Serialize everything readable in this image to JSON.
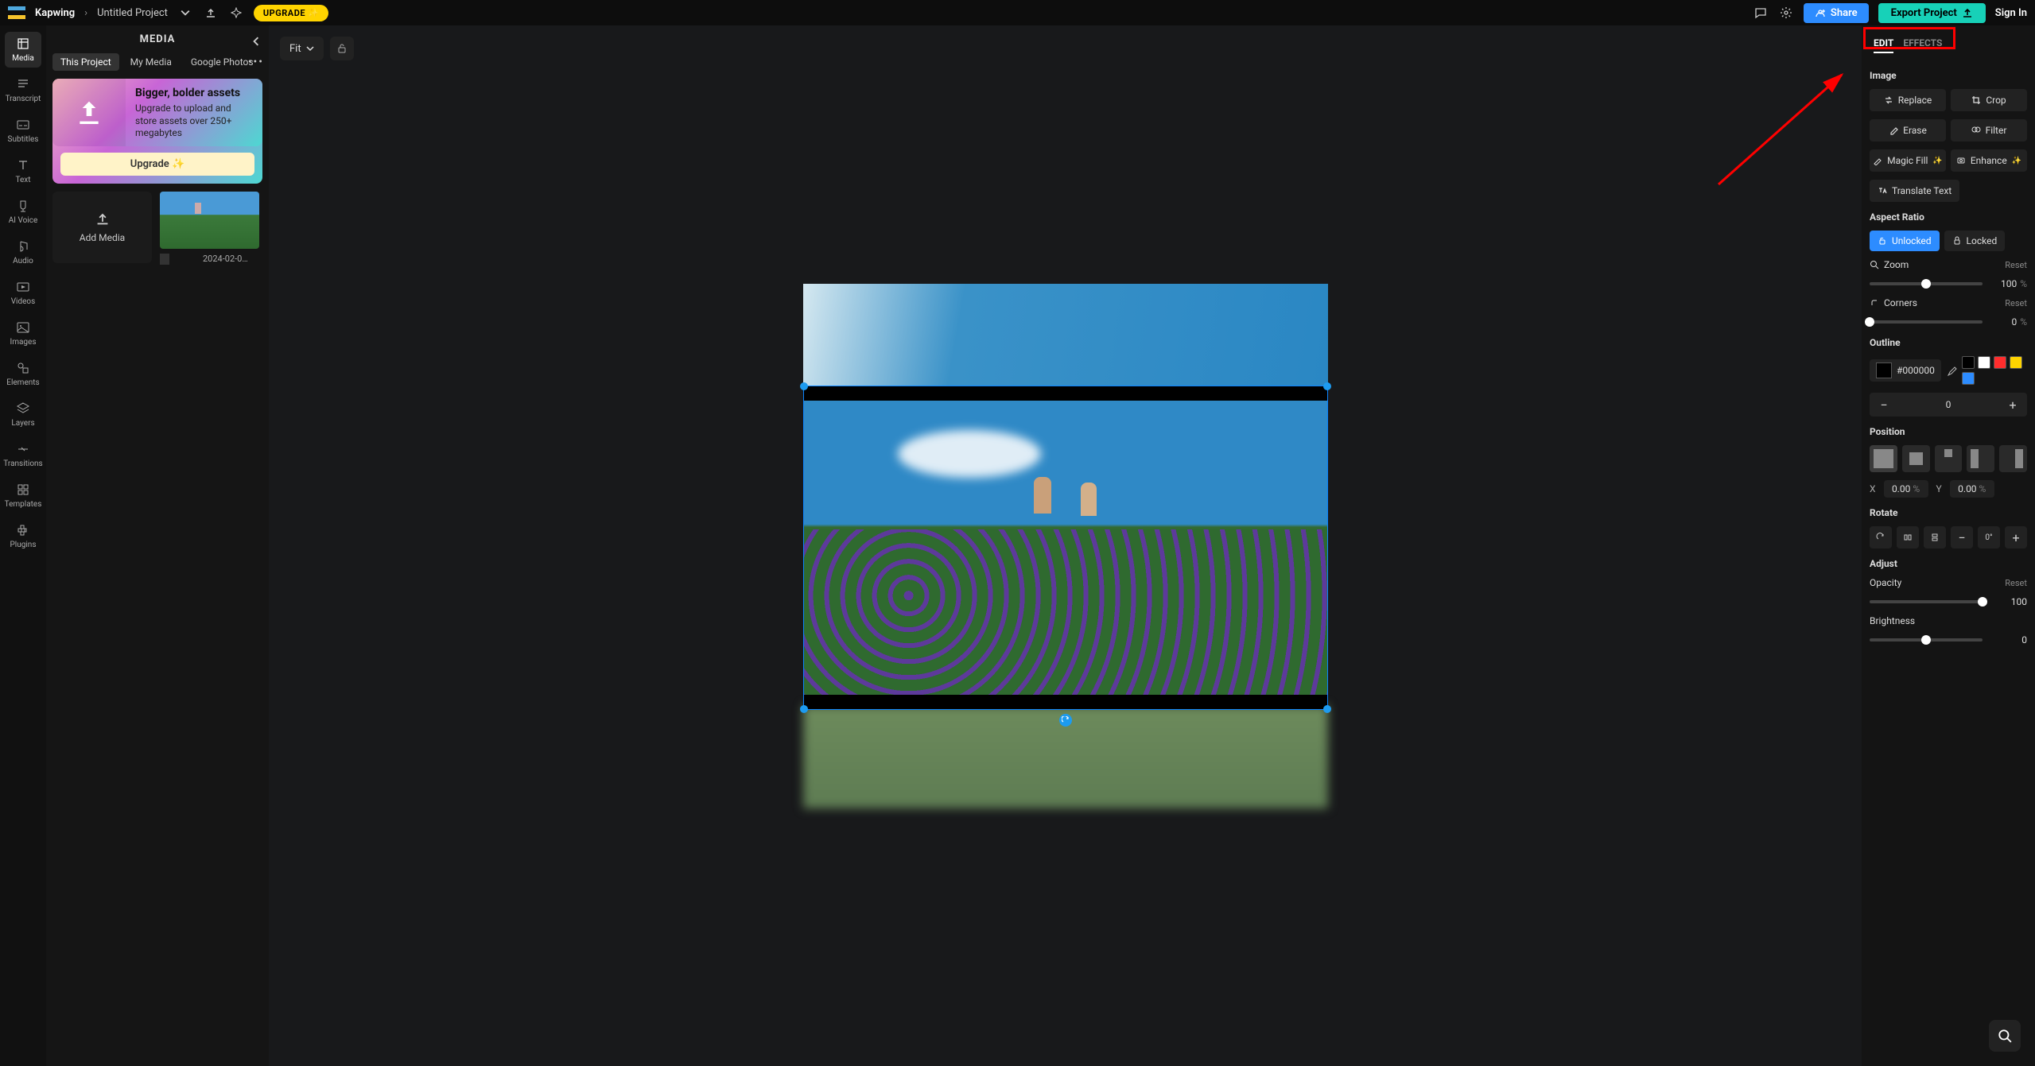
{
  "top": {
    "brand": "Kapwing",
    "project": "Untitled Project",
    "upgrade_pill": "UPGRADE ✨",
    "share": "Share",
    "export": "Export Project",
    "signin": "Sign In"
  },
  "rail": [
    {
      "id": "media",
      "label": "Media"
    },
    {
      "id": "transcript",
      "label": "Transcript"
    },
    {
      "id": "subtitles",
      "label": "Subtitles"
    },
    {
      "id": "text",
      "label": "Text"
    },
    {
      "id": "aivoice",
      "label": "AI Voice"
    },
    {
      "id": "audio",
      "label": "Audio"
    },
    {
      "id": "videos",
      "label": "Videos"
    },
    {
      "id": "images",
      "label": "Images"
    },
    {
      "id": "elements",
      "label": "Elements"
    },
    {
      "id": "layers",
      "label": "Layers"
    },
    {
      "id": "transitions",
      "label": "Transitions"
    },
    {
      "id": "templates",
      "label": "Templates"
    },
    {
      "id": "plugins",
      "label": "Plugins"
    }
  ],
  "panel": {
    "title": "MEDIA",
    "tabs": [
      "This Project",
      "My Media",
      "Google Photos"
    ],
    "active_tab": 0,
    "promo": {
      "title": "Bigger, bolder assets",
      "desc": "Upgrade to upload and store assets over 250+ megabytes",
      "cta": "Upgrade ✨"
    },
    "add_media": "Add Media",
    "thumb_label": "2024-02-0…"
  },
  "canvas": {
    "fit": "Fit"
  },
  "rside": {
    "tabs": [
      "EDIT",
      "EFFECTS"
    ],
    "active_tab": 0,
    "image_section": "Image",
    "buttons": {
      "replace": "Replace",
      "crop": "Crop",
      "erase": "Erase",
      "filter": "Filter",
      "magicfill": "Magic Fill",
      "enhance": "Enhance",
      "translate": "Translate Text"
    },
    "aspect": {
      "title": "Aspect Ratio",
      "unlocked": "Unlocked",
      "locked": "Locked"
    },
    "zoom": {
      "title": "Zoom",
      "reset": "Reset",
      "value": "100",
      "unit": "%",
      "pct": 50
    },
    "corners": {
      "title": "Corners",
      "reset": "Reset",
      "value": "0",
      "unit": "%",
      "pct": 0
    },
    "outline": {
      "title": "Outline",
      "hex": "#000000",
      "stroke": "0",
      "swatches": [
        "#000000",
        "#ffffff",
        "#ff2d2d",
        "#ffd400",
        "#2d8cff"
      ]
    },
    "position": {
      "title": "Position",
      "x_label": "X",
      "x": "0.00",
      "y_label": "Y",
      "y": "0.00",
      "unit": "%"
    },
    "rotate": {
      "title": "Rotate"
    },
    "adjust": {
      "title": "Adjust",
      "opacity_label": "Opacity",
      "opacity_reset": "Reset",
      "opacity_value": "100",
      "opacity_pct": 100,
      "brightness_label": "Brightness",
      "brightness_value": "0",
      "brightness_pct": 50
    }
  }
}
